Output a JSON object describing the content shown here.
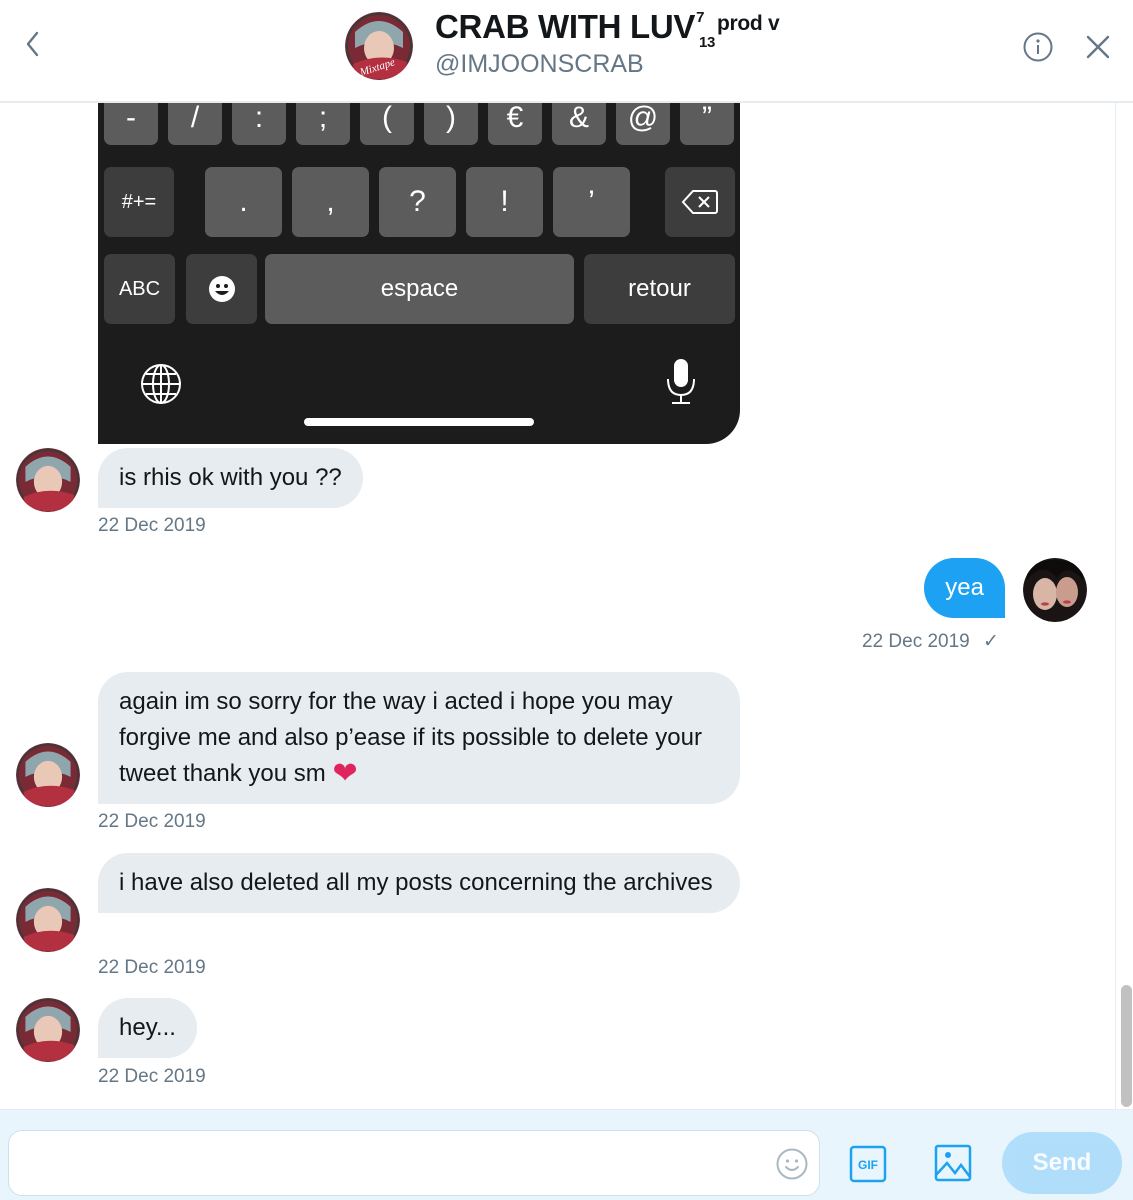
{
  "header": {
    "name": "CRAB WITH LUV",
    "name_sup": "7",
    "name_sub": "13",
    "name_suffix": "prod v",
    "handle": "@IMJOONSCRAB",
    "back_icon": "chevron-left-icon",
    "info_icon": "info-icon",
    "close_icon": "close-icon"
  },
  "keyboard_image": {
    "row1": [
      "-",
      "/",
      ":",
      ";",
      "(",
      ")",
      "€",
      "&",
      "@",
      "”"
    ],
    "row2_left": "#+=",
    "row2": [
      ".",
      ",",
      "?",
      "!",
      "’"
    ],
    "row2_right_icon": "backspace-icon",
    "row3_abc": "ABC",
    "row3_emoji_icon": "emoji-icon",
    "row3_space": "espace",
    "row3_return": "retour",
    "globe_icon": "globe-icon",
    "mic_icon": "microphone-icon"
  },
  "messages": [
    {
      "direction": "incoming",
      "text": "is rhis ok with you ??",
      "timestamp": "22 Dec 2019"
    },
    {
      "direction": "outgoing",
      "text": "yea",
      "timestamp": "22 Dec 2019",
      "status": "✓"
    },
    {
      "direction": "incoming",
      "text": "again im so sorry for the way i acted i hope you may forgive me and also p’ease if its possible to delete your tweet thank you sm",
      "emoji": "❤",
      "timestamp": "22 Dec 2019"
    },
    {
      "direction": "incoming",
      "text": "i have also deleted all my posts concerning the archives",
      "timestamp": "22 Dec 2019"
    },
    {
      "direction": "incoming",
      "text": "hey...",
      "timestamp": "22 Dec 2019"
    }
  ],
  "composer": {
    "placeholder": "",
    "value": "",
    "gif_label": "GIF",
    "send_label": "Send"
  },
  "colors": {
    "accent": "#1da1f2",
    "bubble_in": "#e6ecf0",
    "muted_text": "#657786",
    "heart": "#e0245e"
  }
}
